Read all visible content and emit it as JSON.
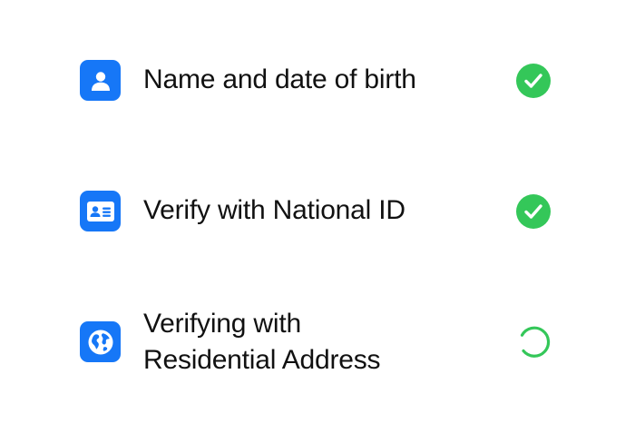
{
  "colors": {
    "accent_blue": "#1677f7",
    "success_green": "#34c759",
    "text": "#111111",
    "background": "#ffffff"
  },
  "steps": [
    {
      "icon": "person-icon",
      "label": "Name and date of birth",
      "status": "complete",
      "status_icon": "checkmark-circle-icon"
    },
    {
      "icon": "id-card-icon",
      "label": "Verify with National ID",
      "status": "complete",
      "status_icon": "checkmark-circle-icon"
    },
    {
      "icon": "globe-icon",
      "label_line1": "Verifying with",
      "label_line2": "Residential Address",
      "status": "in-progress",
      "status_icon": "loading-spinner-icon"
    }
  ]
}
